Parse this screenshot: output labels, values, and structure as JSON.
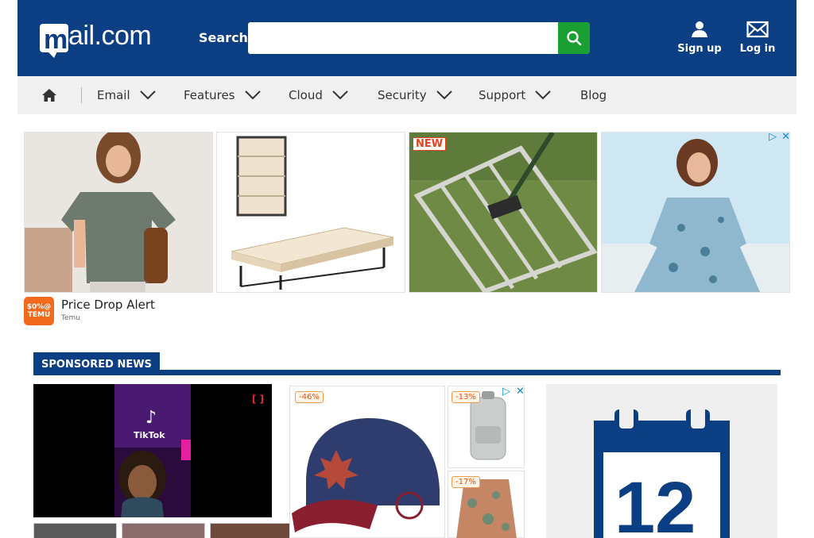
{
  "header": {
    "logo_text_first": "m",
    "logo_text_rest": "ail.com",
    "search_label": "Search",
    "search_placeholder": "",
    "signup_label": "Sign up",
    "login_label": "Log in"
  },
  "nav": {
    "items": [
      {
        "label": "Email",
        "has_dropdown": true
      },
      {
        "label": "Features",
        "has_dropdown": true
      },
      {
        "label": "Cloud",
        "has_dropdown": true
      },
      {
        "label": "Security",
        "has_dropdown": true
      },
      {
        "label": "Support",
        "has_dropdown": true
      },
      {
        "label": "Blog",
        "has_dropdown": false
      }
    ]
  },
  "ad": {
    "new_badge": "NEW",
    "title": "Price Drop Alert",
    "advertiser": "Temu",
    "brand_line1": "$0%@",
    "brand_line2": "TEMU"
  },
  "sponsored": {
    "heading": "SPONSORED NEWS",
    "video_brand": "TikTok",
    "video_marker": "[ ]",
    "discounts": [
      "-46%",
      "-13%",
      "-17%"
    ],
    "calendar_day": "12"
  },
  "colors": {
    "brand_blue": "#0c3e83",
    "search_green": "#1a9f33",
    "nav_bg": "#f0f0f0",
    "ad_link": "#0a8fd8",
    "temu_orange": "#f26b1d"
  }
}
